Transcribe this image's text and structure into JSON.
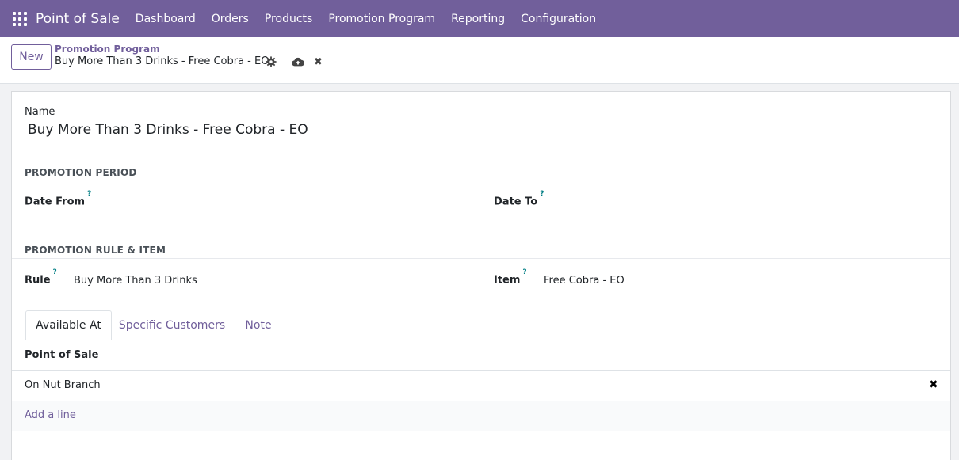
{
  "navbar": {
    "brand": "Point of Sale",
    "menu": [
      "Dashboard",
      "Orders",
      "Products",
      "Promotion Program",
      "Reporting",
      "Configuration"
    ]
  },
  "control_panel": {
    "new_label": "New",
    "breadcrumb_parent": "Promotion Program",
    "breadcrumb_current": "Buy More Than 3 Drinks - Free Cobra - EO",
    "discard_glyph": "✖"
  },
  "form": {
    "name_label": "Name",
    "name_value": "Buy More Than 3 Drinks - Free Cobra - EO",
    "promotion_period": {
      "title": "PROMOTION PERIOD",
      "date_from_label": "Date From",
      "date_to_label": "Date To"
    },
    "promotion_rule": {
      "title": "PROMOTION RULE & ITEM",
      "rule_label": "Rule",
      "rule_value": "Buy More Than 3 Drinks",
      "item_label": "Item",
      "item_value": "Free Cobra - EO"
    },
    "help_marker": "?",
    "tabs": [
      "Available At",
      "Specific Customers",
      "Note"
    ],
    "list": {
      "header": "Point of Sale",
      "rows": [
        "On Nut Branch"
      ],
      "remove_glyph": "✖",
      "add_line": "Add a line"
    }
  },
  "colors": {
    "brand": "#715f9b",
    "help": "#017e84"
  },
  "icons": [
    "apps-grid-icon",
    "gear-icon",
    "cloud-upload-icon",
    "close-icon",
    "remove-row-icon"
  ]
}
